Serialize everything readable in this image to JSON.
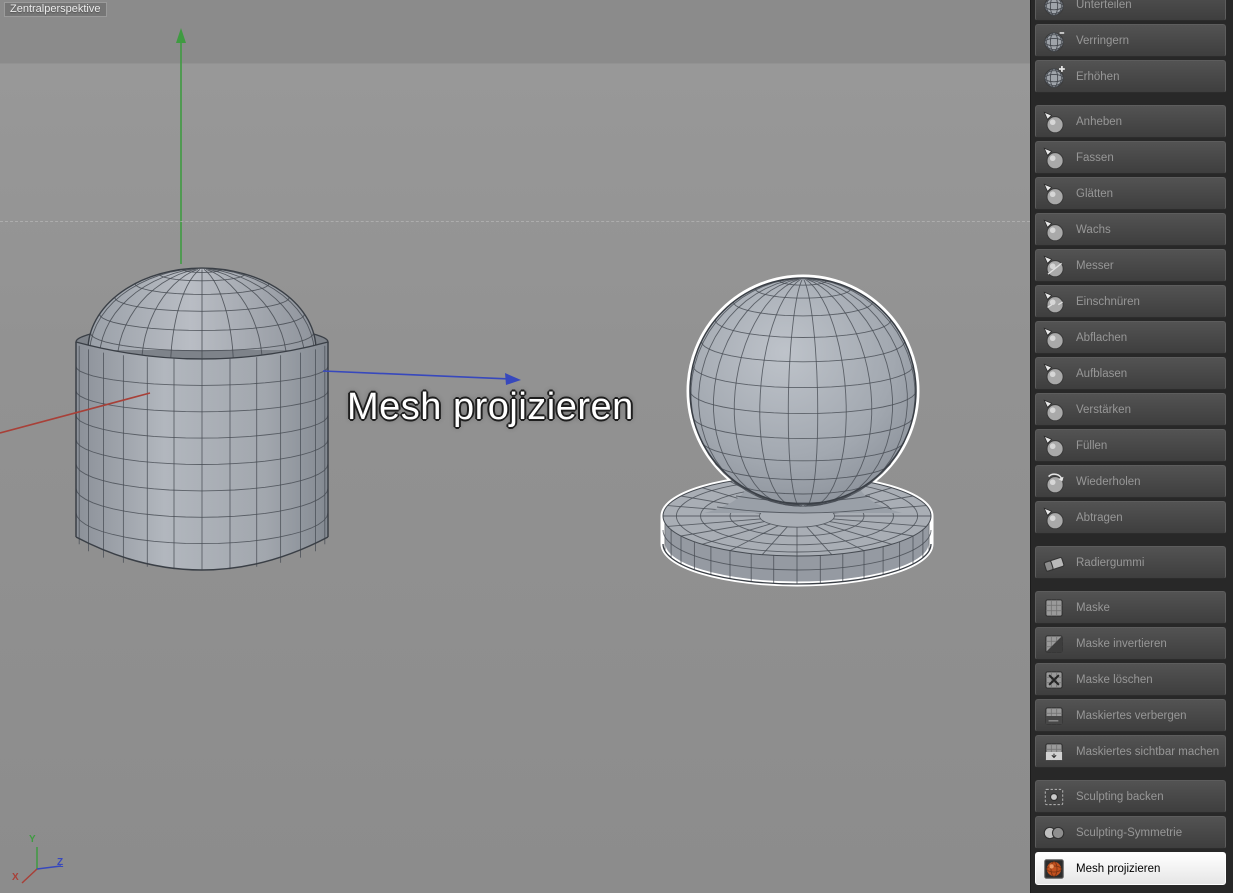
{
  "viewport": {
    "camera_label": "Zentralperspektive",
    "overlay_text": "Mesh projizieren",
    "axis_gizmo": {
      "x_label": "X",
      "y_label": "Y",
      "z_label": "Z"
    },
    "axis_colors": {
      "x": "#a84038",
      "y": "#3f9b41",
      "z": "#3748bd"
    }
  },
  "sidebar": {
    "selected_tool": "Mesh projizieren",
    "groups": [
      {
        "items": [
          {
            "label": "Unterteilen",
            "icon": "subdivide-icon"
          },
          {
            "label": "Verringern",
            "icon": "decrease-icon"
          },
          {
            "label": "Erhöhen",
            "icon": "increase-icon"
          }
        ]
      },
      {
        "items": [
          {
            "label": "Anheben",
            "icon": "pull-icon"
          },
          {
            "label": "Fassen",
            "icon": "grab-icon"
          },
          {
            "label": "Glätten",
            "icon": "smooth-icon"
          },
          {
            "label": "Wachs",
            "icon": "wax-icon"
          },
          {
            "label": "Messer",
            "icon": "knife-icon"
          },
          {
            "label": "Einschnüren",
            "icon": "pinch-icon"
          },
          {
            "label": "Abflachen",
            "icon": "flatten-icon"
          },
          {
            "label": "Aufblasen",
            "icon": "inflate-icon"
          },
          {
            "label": "Verstärken",
            "icon": "amplify-icon"
          },
          {
            "label": "Füllen",
            "icon": "fill-icon"
          },
          {
            "label": "Wiederholen",
            "icon": "repeat-icon"
          },
          {
            "label": "Abtragen",
            "icon": "scrape-icon"
          }
        ]
      },
      {
        "items": [
          {
            "label": "Radiergummi",
            "icon": "eraser-icon"
          }
        ]
      },
      {
        "items": [
          {
            "label": "Maske",
            "icon": "mask-icon"
          },
          {
            "label": "Maske invertieren",
            "icon": "mask-invert-icon"
          },
          {
            "label": "Maske löschen",
            "icon": "mask-delete-icon"
          },
          {
            "label": "Maskiertes verbergen",
            "icon": "mask-hide-icon"
          },
          {
            "label": "Maskiertes sichtbar machen",
            "icon": "mask-show-icon"
          }
        ]
      },
      {
        "items": [
          {
            "label": "Sculpting backen",
            "icon": "bake-icon"
          },
          {
            "label": "Sculpting-Symmetrie",
            "icon": "symmetry-icon"
          },
          {
            "label": "Mesh projizieren",
            "icon": "mesh-project-icon",
            "selected": true
          }
        ]
      }
    ]
  }
}
